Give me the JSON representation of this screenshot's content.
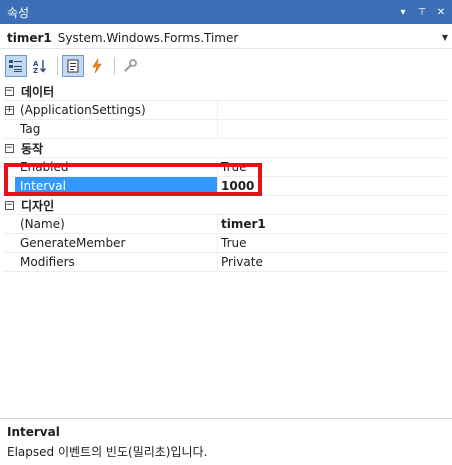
{
  "window": {
    "title": "속성",
    "buttons": {
      "dropdown": "▾",
      "pin": "⊤",
      "close": "✕"
    }
  },
  "object_selector": {
    "name": "timer1",
    "type": "System.Windows.Forms.Timer"
  },
  "toolbar": {
    "items": [
      "categorized-icon",
      "alphabetical-icon",
      "properties-icon",
      "events-icon",
      "property-pages-icon"
    ]
  },
  "grid": {
    "categories": [
      {
        "label": "데이터",
        "expanded": true,
        "rows": [
          {
            "name": "(ApplicationSettings)",
            "value": "",
            "expandable": true
          },
          {
            "name": "Tag",
            "value": ""
          }
        ]
      },
      {
        "label": "동작",
        "expanded": true,
        "rows": [
          {
            "name": "Enabled",
            "value": "True"
          },
          {
            "name": "Interval",
            "value": "1000",
            "selected": true
          }
        ]
      },
      {
        "label": "디자인",
        "expanded": true,
        "rows": [
          {
            "name": "(Name)",
            "value": "timer1"
          },
          {
            "name": "GenerateMember",
            "value": "True"
          },
          {
            "name": "Modifiers",
            "value": "Private"
          }
        ]
      }
    ]
  },
  "description": {
    "title": "Interval",
    "text": "Elapsed 이벤트의 빈도(밀리초)입니다."
  },
  "colors": {
    "titlebar": "#3b6fb6",
    "selection": "#3399ff",
    "highlight_box": "#e1121a"
  }
}
